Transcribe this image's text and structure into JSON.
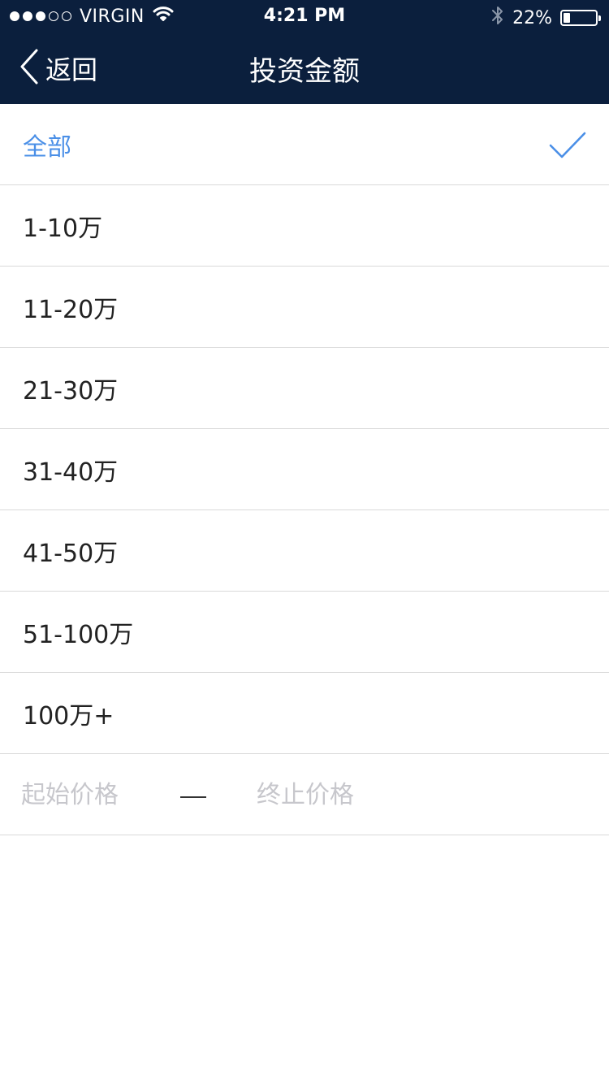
{
  "status_bar": {
    "carrier": "VIRGIN",
    "time": "4:21 PM",
    "battery": "22%",
    "battery_level": 0.22,
    "signal_strength": 3,
    "signal_max": 5,
    "icons": [
      "wifi-icon",
      "bluetooth-icon",
      "battery-icon"
    ]
  },
  "nav": {
    "back_label": "返回",
    "title": "投资金额"
  },
  "options": [
    {
      "label": "全部",
      "selected": true
    },
    {
      "label": "1-10万",
      "selected": false
    },
    {
      "label": "11-20万",
      "selected": false
    },
    {
      "label": "21-30万",
      "selected": false
    },
    {
      "label": "31-40万",
      "selected": false
    },
    {
      "label": "41-50万",
      "selected": false
    },
    {
      "label": "51-100万",
      "selected": false
    },
    {
      "label": "100万+",
      "selected": false
    }
  ],
  "range": {
    "start_placeholder": "起始价格",
    "end_placeholder": "终止价格",
    "start_value": "",
    "end_value": ""
  },
  "colors": {
    "nav_background": "#0b1f3d",
    "accent": "#4a8fe7",
    "divider": "#d9d9d9",
    "placeholder": "#c7c7cc"
  }
}
